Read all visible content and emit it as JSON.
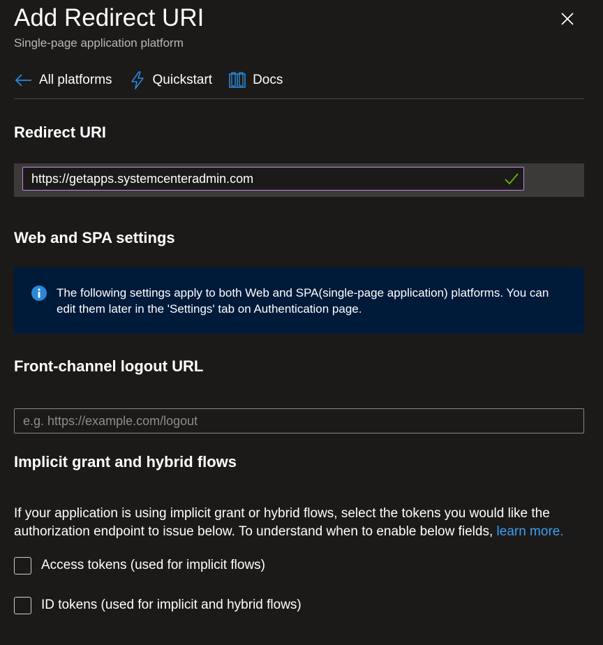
{
  "header": {
    "title": "Add Redirect URI",
    "subtitle": "Single-page application platform"
  },
  "toolbar": {
    "items": [
      {
        "label": "All platforms",
        "icon": "arrow-left-icon"
      },
      {
        "label": "Quickstart",
        "icon": "lightning-icon"
      },
      {
        "label": "Docs",
        "icon": "book-icon"
      }
    ]
  },
  "redirect": {
    "heading": "Redirect URI",
    "value": "https://getapps.systemcenteradmin.com",
    "valid": true
  },
  "web_spa": {
    "heading": "Web and SPA settings",
    "info": "The following settings apply to both Web and SPA(single-page application) platforms. You can edit them later in the 'Settings' tab on Authentication page."
  },
  "logout": {
    "heading": "Front-channel logout URL",
    "placeholder": "e.g. https://example.com/logout",
    "value": ""
  },
  "implicit": {
    "heading": "Implicit grant and hybrid flows",
    "description": "If your application is using implicit grant or hybrid flows, select the tokens you would like the authorization endpoint to issue below. To understand when to enable below fields,",
    "link": "learn more.",
    "checkboxes": [
      {
        "label": "Access tokens (used for implicit flows)",
        "checked": false
      },
      {
        "label": "ID tokens (used for implicit and hybrid flows)",
        "checked": false
      }
    ]
  },
  "colors": {
    "background": "#1b1a19",
    "accent": "#0078d4",
    "link": "#3aa0f3",
    "info_bg": "#001a3a",
    "focus_border": "#c586e6",
    "valid_check": "#6bb700"
  }
}
